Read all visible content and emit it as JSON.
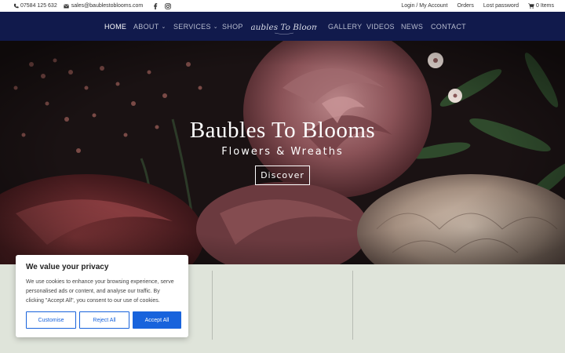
{
  "topbar": {
    "phone": "07584 125 632",
    "email": "sales@baublestoblooms.com",
    "social": [
      "facebook-icon",
      "instagram-icon"
    ],
    "links": [
      "Login / My Account",
      "Orders",
      "Lost password"
    ],
    "cart": "0 Items"
  },
  "nav": {
    "items": [
      {
        "label": "HOME",
        "active": true
      },
      {
        "label": "ABOUT",
        "has_dropdown": true
      },
      {
        "label": "SERVICES",
        "has_dropdown": true
      },
      {
        "label": "SHOP"
      },
      {
        "label": "GALLERY"
      },
      {
        "label": "VIDEOS"
      },
      {
        "label": "NEWS"
      },
      {
        "label": "CONTACT"
      }
    ],
    "logo_text": "Baubles To Blooms",
    "caret": "⌄"
  },
  "hero": {
    "title": "Baubles To Blooms",
    "subtitle": "Flowers & Wreaths",
    "button": "Discover"
  },
  "cookie": {
    "title": "We value your privacy",
    "text": "We use cookies to enhance your browsing experience, serve personalised ads or content, and analyse our traffic. By clicking \"Accept All\", you consent to our use of cookies.",
    "buttons": {
      "customise": "Customise",
      "reject": "Reject All",
      "accept": "Accept All"
    }
  },
  "colors": {
    "nav_bg": "#111a4c",
    "accent_blue": "#1863dc",
    "lower_bg": "#dfe4da"
  }
}
